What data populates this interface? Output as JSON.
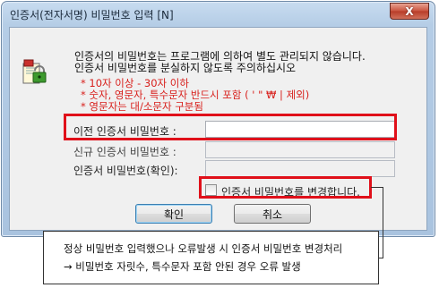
{
  "window": {
    "title": "인증서(전자서명) 비밀번호 입력 [N]",
    "close_label": "X"
  },
  "notice": {
    "line1": "인증서의 비밀번호는 프로그램에 의하여 별도 관리되지 않습니다.",
    "line2": "인증서 비밀번호를 분실하지 않도록 주의하십시오",
    "rules": [
      "* 10자 이상 - 30자 이하",
      "* 숫자, 영문자, 특수문자 반드시 포함 ( ' \" ₩ | 제외)",
      "* 영문자는 대/소문자 구분됨"
    ]
  },
  "fields": {
    "old_label": "이전 인증서 비밀번호 :",
    "new_label": "신규 인증서 비밀번호 :",
    "confirm_label": "인증서 비밀번호(확인):"
  },
  "change_checkbox": {
    "label": "인증서 비밀번호를 변경합니다.",
    "checked": false
  },
  "buttons": {
    "ok": "확인",
    "cancel": "취소"
  },
  "annotation": {
    "line1": "정상 비밀번호 입력했으나 오류발생 시 인증서 비밀번호 변경처리",
    "line2": "→ 비밀번호 자릿수, 특수문자 포함 안된 경우 오류 발생"
  },
  "colors": {
    "highlight": "#e0101a",
    "rule_text": "#d8201c",
    "titlebar": "#b5cde6"
  }
}
